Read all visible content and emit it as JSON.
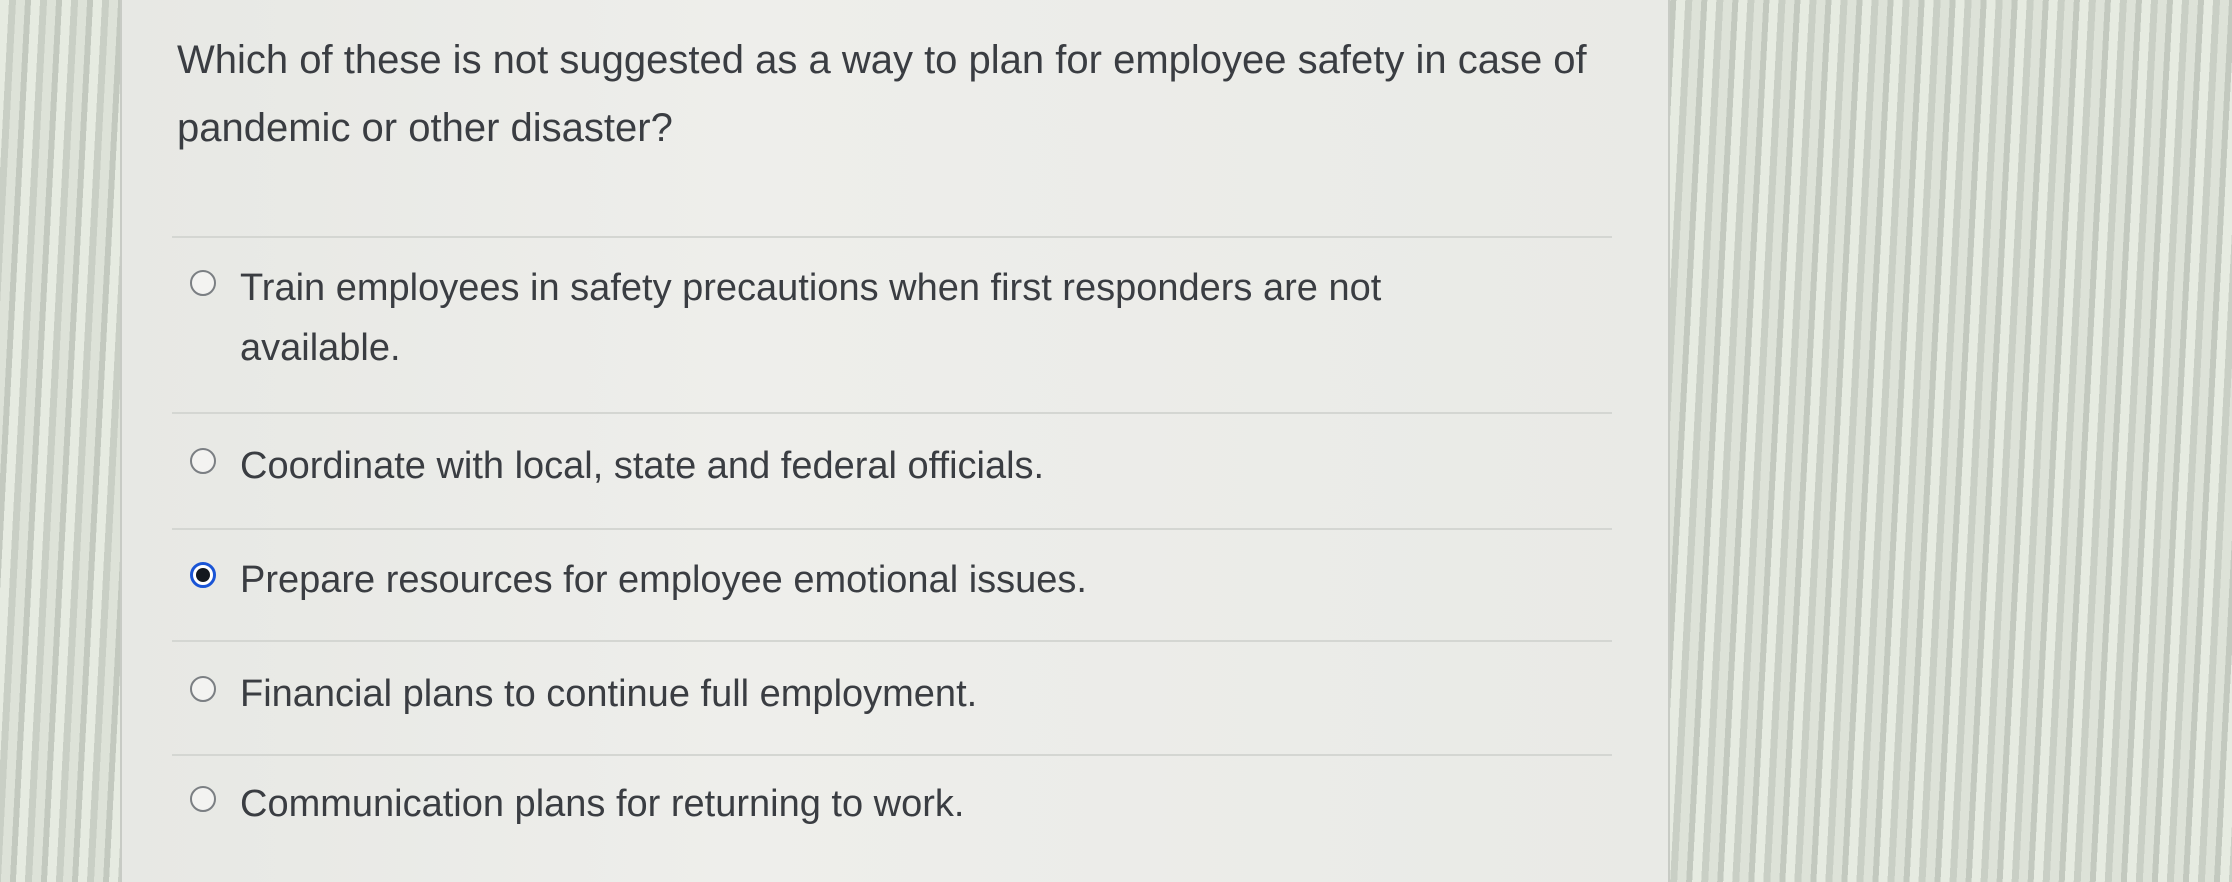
{
  "question": {
    "text": "Which of these is not suggested as a way to plan for employee safety in case of pandemic or other disaster?"
  },
  "options": [
    {
      "label": "Train employees in safety precautions when first responders are not available.",
      "selected": false
    },
    {
      "label": "Coordinate with local, state and federal officials.",
      "selected": false
    },
    {
      "label": "Prepare resources for employee emotional issues.",
      "selected": true
    },
    {
      "label": "Financial plans to continue full employment.",
      "selected": false
    },
    {
      "label": "Communication plans for returning to work.",
      "selected": false
    }
  ],
  "colors": {
    "text": "#3a3d42",
    "radio_selected_ring": "#1a55d6",
    "radio_border": "#7b7f83"
  }
}
